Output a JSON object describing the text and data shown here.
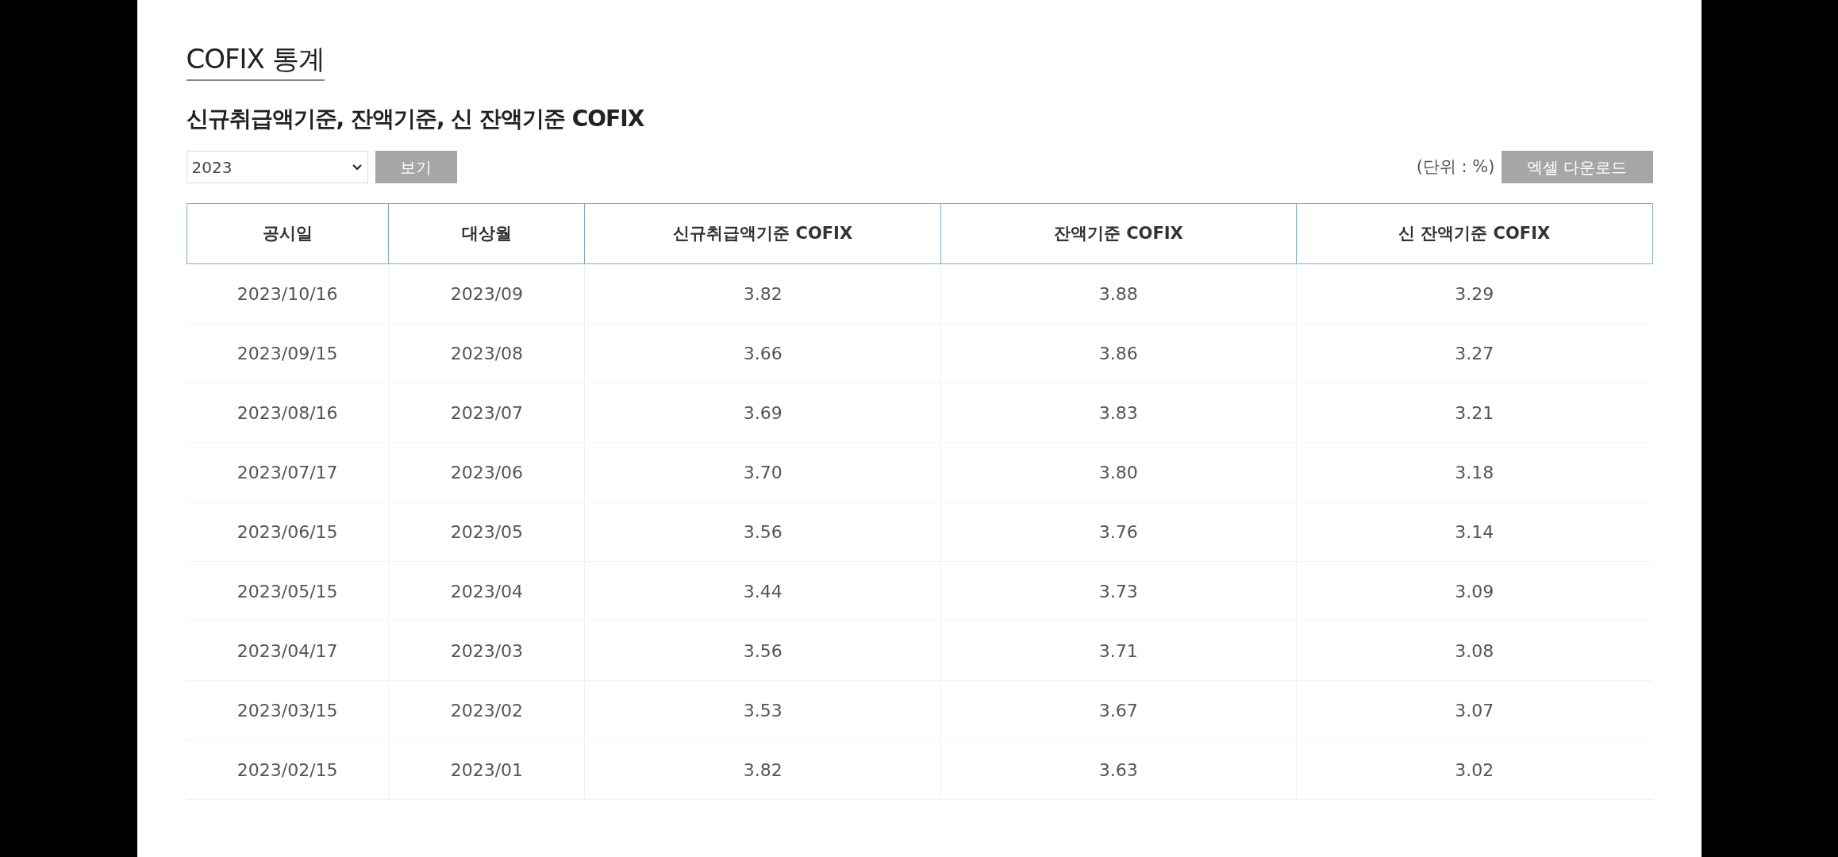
{
  "page_title": "COFIX 통계",
  "section_title": "신규취급액기준, 잔액기준, 신 잔액기준 COFIX",
  "year_select": {
    "value": "2023"
  },
  "view_button": "보기",
  "unit_note": "(단위 : %)",
  "excel_button": "엑셀 다운로드",
  "table": {
    "columns": [
      "공시일",
      "대상월",
      "신규취급액기준 COFIX",
      "잔액기준 COFIX",
      "신 잔액기준 COFIX"
    ],
    "rows": [
      [
        "2023/10/16",
        "2023/09",
        "3.82",
        "3.88",
        "3.29"
      ],
      [
        "2023/09/15",
        "2023/08",
        "3.66",
        "3.86",
        "3.27"
      ],
      [
        "2023/08/16",
        "2023/07",
        "3.69",
        "3.83",
        "3.21"
      ],
      [
        "2023/07/17",
        "2023/06",
        "3.70",
        "3.80",
        "3.18"
      ],
      [
        "2023/06/15",
        "2023/05",
        "3.56",
        "3.76",
        "3.14"
      ],
      [
        "2023/05/15",
        "2023/04",
        "3.44",
        "3.73",
        "3.09"
      ],
      [
        "2023/04/17",
        "2023/03",
        "3.56",
        "3.71",
        "3.08"
      ],
      [
        "2023/03/15",
        "2023/02",
        "3.53",
        "3.67",
        "3.07"
      ],
      [
        "2023/02/15",
        "2023/01",
        "3.82",
        "3.63",
        "3.02"
      ]
    ]
  }
}
